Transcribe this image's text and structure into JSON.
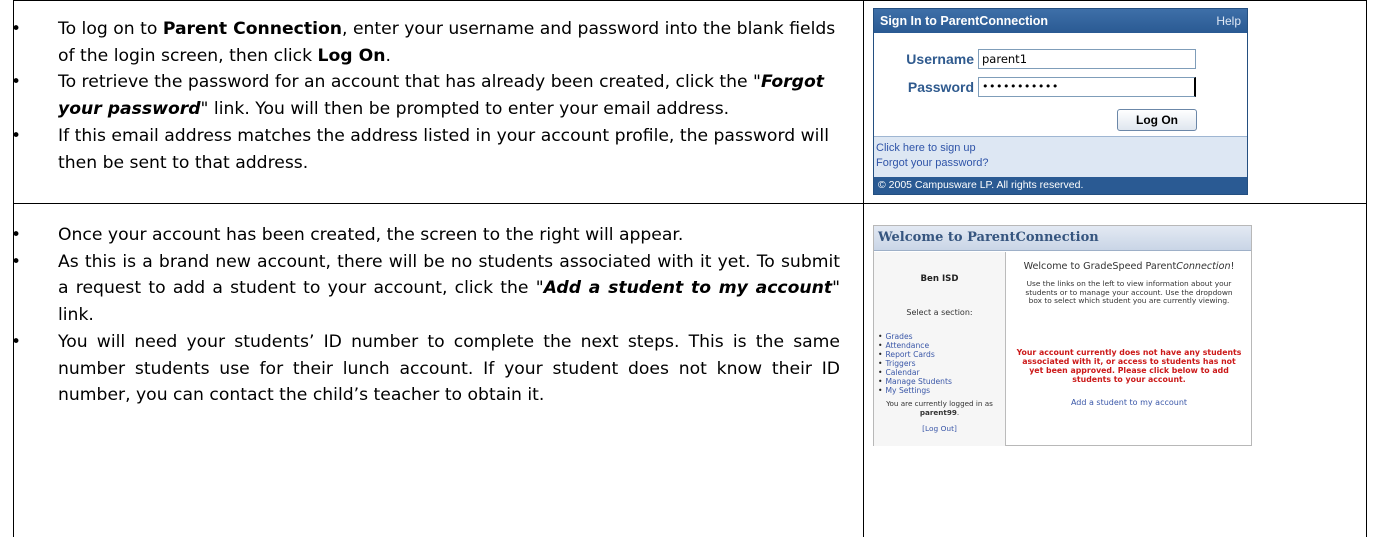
{
  "section1": {
    "bullets": [
      [
        "To log on to ",
        {
          "b": "Parent Connection"
        },
        ", enter your username and password into the blank fields of the login screen, then click ",
        {
          "b": "Log On"
        },
        "."
      ],
      [
        "To retrieve the password for an account that has already been created, click the \"",
        {
          "bi": "Forgot your password"
        },
        "\" link.  You will then be prompted to enter your email address."
      ],
      [
        "If this email address matches the address listed in your account profile, the password will then be sent to that address."
      ]
    ]
  },
  "section2": {
    "bullets": [
      [
        "Once your account has been created, the screen to the right will appear."
      ],
      [
        "As this is a brand new account, there will be no students associated with it yet. To submit a request to add a student to your account, click the \"",
        {
          "bi": "Add a student to my account"
        },
        "\" link."
      ],
      [
        "You will need your students’ ID number to complete the next steps. This is the same number students use for their lunch account. If your student does not know their ID number, you can contact the child’s teacher to obtain it."
      ]
    ]
  },
  "login": {
    "title": "Sign In to ParentConnection",
    "help": "Help",
    "username_label": "Username",
    "username_value": "parent1",
    "password_label": "Password",
    "password_value": "•••••••••••",
    "logon_button": "Log On",
    "signup_link": "Click here to sign up",
    "forgot_link": "Forgot your password?",
    "copyright": "© 2005 Campusware LP. All rights reserved."
  },
  "welcome": {
    "header": "Welcome to ParentConnection",
    "district": "Ben ISD",
    "select_section": "Select a section:",
    "menu": [
      "Grades",
      "Attendance",
      "Report Cards",
      "Triggers",
      "Calendar",
      "Manage Students",
      "My Settings"
    ],
    "logged_in_prefix": "You are currently logged in as",
    "username": "parent99",
    "logout": "[Log Out]",
    "title_prefix": "Welcome to GradeSpeed Parent",
    "title_italic": "Connection",
    "title_suffix": "!",
    "intro": "Use the links on the left to view information about your students or to manage your account.  Use the dropdown box to select which student you are currently viewing.",
    "warning": "Your account currently does not have any students associated with it, or access to students has not yet been approved. Please click below to add students to your account.",
    "add_link": "Add a student to my account"
  }
}
